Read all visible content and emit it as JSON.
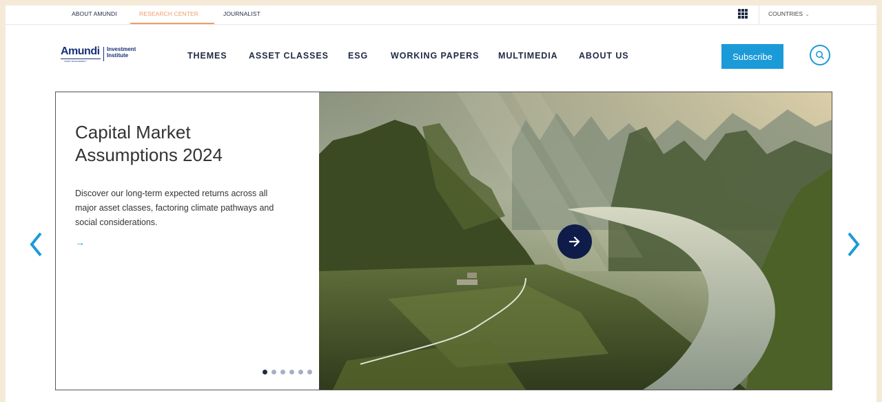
{
  "topbar": {
    "links": [
      "ABOUT AMUNDI",
      "RESEARCH CENTER",
      "JOURNALIST"
    ],
    "active_link": "RESEARCH CENTER",
    "countries_label": "COUNTRIES",
    "accent_color": "#f29b6a"
  },
  "logo": {
    "brand": "Amundi",
    "product_line1": "Investment",
    "product_line2": "Institute",
    "tagline": "ASSET MANAGEMENT"
  },
  "nav": {
    "items": [
      "THEMES",
      "ASSET CLASSES",
      "ESG",
      "WORKING PAPERS",
      "MULTIMEDIA",
      "ABOUT US"
    ],
    "subscribe_label": "Subscribe",
    "brand_color": "#1b9ad8"
  },
  "hero": {
    "title": "Capital Market Assumptions 2024",
    "description": "Discover our long-term expected returns across all major asset classes, factoring climate pathways and social considerations.",
    "link_icon": "arrow-right-icon",
    "slide_count": 6,
    "active_slide": 1,
    "image": "misty karst mountains and river valley"
  },
  "icons": {
    "apps": "grid-icon",
    "search": "search-icon",
    "prev": "chevron-left-icon",
    "next": "chevron-right-icon",
    "cta": "arrow-right-icon"
  }
}
